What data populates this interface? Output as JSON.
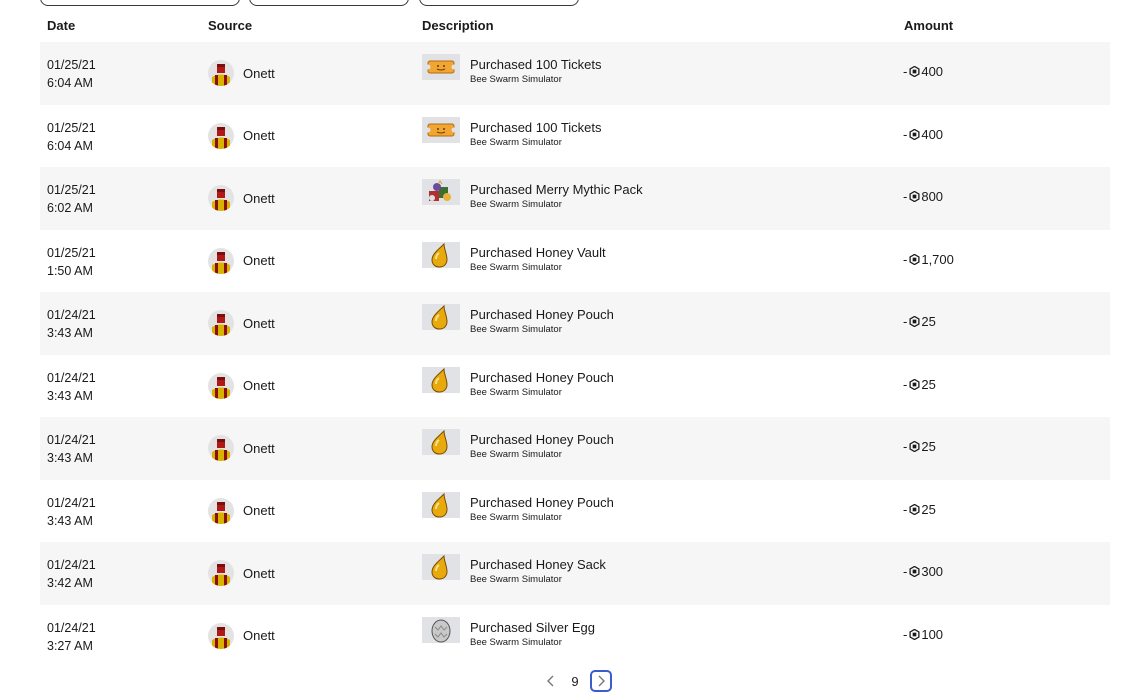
{
  "columns": {
    "date": "Date",
    "source": "Source",
    "description": "Description",
    "amount": "Amount"
  },
  "rows": [
    {
      "date": "01/25/21",
      "time": "6:04 AM",
      "source": "Onett",
      "title": "Purchased 100 Tickets",
      "game": "Bee Swarm Simulator",
      "sign": "-",
      "amount": "400",
      "thumb": "ticket-icon"
    },
    {
      "date": "01/25/21",
      "time": "6:04 AM",
      "source": "Onett",
      "title": "Purchased 100 Tickets",
      "game": "Bee Swarm Simulator",
      "sign": "-",
      "amount": "400",
      "thumb": "ticket-icon"
    },
    {
      "date": "01/25/21",
      "time": "6:02 AM",
      "source": "Onett",
      "title": "Purchased Merry Mythic Pack",
      "game": "Bee Swarm Simulator",
      "sign": "-",
      "amount": "800",
      "thumb": "gift-pack-icon"
    },
    {
      "date": "01/25/21",
      "time": "1:50 AM",
      "source": "Onett",
      "title": "Purchased Honey Vault",
      "game": "Bee Swarm Simulator",
      "sign": "-",
      "amount": "1,700",
      "thumb": "honey-drop-icon"
    },
    {
      "date": "01/24/21",
      "time": "3:43 AM",
      "source": "Onett",
      "title": "Purchased Honey Pouch",
      "game": "Bee Swarm Simulator",
      "sign": "-",
      "amount": "25",
      "thumb": "honey-drop-icon"
    },
    {
      "date": "01/24/21",
      "time": "3:43 AM",
      "source": "Onett",
      "title": "Purchased Honey Pouch",
      "game": "Bee Swarm Simulator",
      "sign": "-",
      "amount": "25",
      "thumb": "honey-drop-icon"
    },
    {
      "date": "01/24/21",
      "time": "3:43 AM",
      "source": "Onett",
      "title": "Purchased Honey Pouch",
      "game": "Bee Swarm Simulator",
      "sign": "-",
      "amount": "25",
      "thumb": "honey-drop-icon"
    },
    {
      "date": "01/24/21",
      "time": "3:43 AM",
      "source": "Onett",
      "title": "Purchased Honey Pouch",
      "game": "Bee Swarm Simulator",
      "sign": "-",
      "amount": "25",
      "thumb": "honey-drop-icon"
    },
    {
      "date": "01/24/21",
      "time": "3:42 AM",
      "source": "Onett",
      "title": "Purchased Honey Sack",
      "game": "Bee Swarm Simulator",
      "sign": "-",
      "amount": "300",
      "thumb": "honey-drop-icon"
    },
    {
      "date": "01/24/21",
      "time": "3:27 AM",
      "source": "Onett",
      "title": "Purchased Silver Egg",
      "game": "Bee Swarm Simulator",
      "sign": "-",
      "amount": "100",
      "thumb": "silver-egg-icon"
    }
  ],
  "pagination": {
    "prev_icon": "chevron-left-icon",
    "page": "9",
    "next_icon": "chevron-right-icon"
  },
  "colors": {
    "alt_row": "#f6f6f6",
    "focus_ring": "#3b5ccc",
    "honey": "#e8a90c"
  }
}
